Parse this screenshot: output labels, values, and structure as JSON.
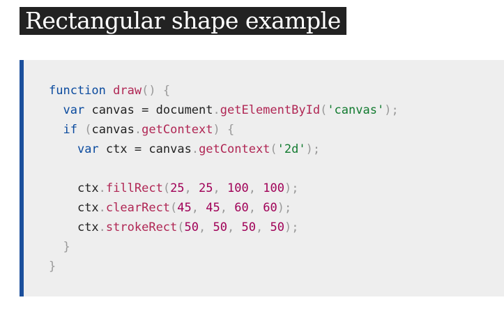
{
  "heading": "Rectangular shape example",
  "code_lines": [
    "function draw() {",
    "  var canvas = document.getElementById('canvas');",
    "  if (canvas.getContext) {",
    "    var ctx = canvas.getContext('2d');",
    "",
    "    ctx.fillRect(25, 25, 100, 100);",
    "    ctx.clearRect(45, 45, 60, 60);",
    "    ctx.strokeRect(50, 50, 50, 50);",
    "  }",
    "}"
  ],
  "colors": {
    "heading_bg": "#222222",
    "accent_bar": "#1b4f9c",
    "code_bg": "#eeeeee",
    "keyword": "#0a4a9e",
    "function": "#b02654",
    "string": "#117a2f",
    "number": "#a00057",
    "punctuation": "#999999"
  }
}
